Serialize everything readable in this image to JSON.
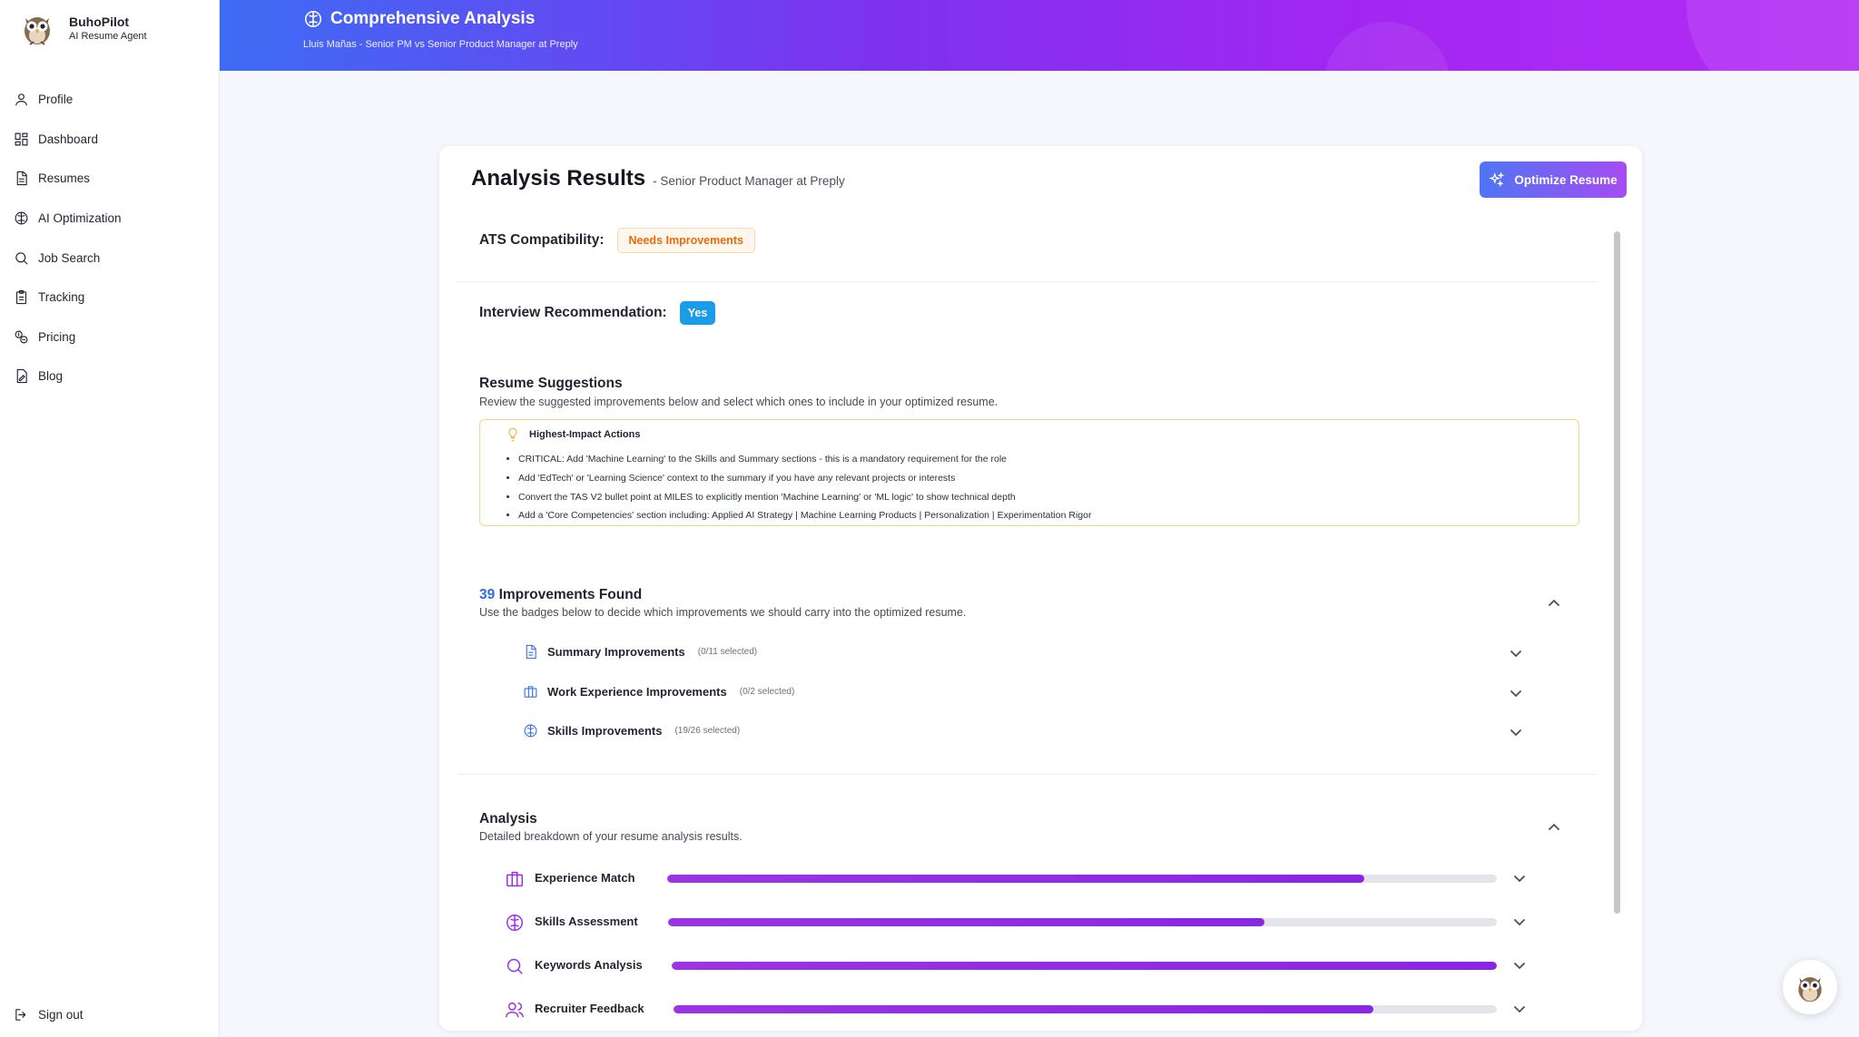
{
  "brand": {
    "name": "BuhoPilot",
    "tagline": "AI Resume Agent"
  },
  "nav": [
    {
      "label": "Profile",
      "icon": "user-icon"
    },
    {
      "label": "Dashboard",
      "icon": "grid-icon"
    },
    {
      "label": "Resumes",
      "icon": "document-icon"
    },
    {
      "label": "AI Optimization",
      "icon": "brain-icon"
    },
    {
      "label": "Job Search",
      "icon": "search-icon"
    },
    {
      "label": "Tracking",
      "icon": "clipboard-icon"
    },
    {
      "label": "Pricing",
      "icon": "tags-icon"
    },
    {
      "label": "Blog",
      "icon": "edit-document-icon"
    }
  ],
  "signout": "Sign out",
  "header": {
    "title": "Comprehensive Analysis",
    "subtitle": "Lluis Mañas - Senior PM vs Senior Product Manager at Preply"
  },
  "card": {
    "title": "Analysis Results",
    "subtitle": "- Senior Product Manager at Preply",
    "optimize_label": "Optimize Resume"
  },
  "ats": {
    "label": "ATS Compatibility:",
    "value": "Needs Improvements"
  },
  "interview": {
    "label": "Interview Recommendation:",
    "value": "Yes"
  },
  "suggestions": {
    "title": "Resume Suggestions",
    "subtitle": "Review the suggested improvements below and select which ones to include in your optimized resume.",
    "box_title": "Highest-Impact Actions",
    "items": [
      "CRITICAL: Add 'Machine Learning' to the Skills and Summary sections - this is a mandatory requirement for the role",
      "Add 'EdTech' or 'Learning Science' context to the summary if you have any relevant projects or interests",
      "Convert the TAS V2 bullet point at MILES to explicitly mention 'Machine Learning' or 'ML logic' to show technical depth",
      "Add a 'Core Competencies' section including: Applied AI Strategy | Machine Learning Products | Personalization | Experimentation Rigor"
    ]
  },
  "improvements": {
    "count": "39",
    "title": "Improvements Found",
    "subtitle": "Use the badges below to decide which improvements we should carry into the optimized resume.",
    "groups": [
      {
        "name": "Summary Improvements",
        "count": "(0/11 selected)",
        "icon": "document-icon"
      },
      {
        "name": "Work Experience Improvements",
        "count": "(0/2 selected)",
        "icon": "briefcase-icon"
      },
      {
        "name": "Skills Improvements",
        "count": "(19/26 selected)",
        "icon": "brain-icon"
      }
    ]
  },
  "analysis": {
    "title": "Analysis",
    "subtitle": "Detailed breakdown of your resume analysis results.",
    "rows": [
      {
        "name": "Experience Match",
        "icon": "briefcase-icon",
        "progress": 0.84
      },
      {
        "name": "Skills Assessment",
        "icon": "brain-icon",
        "progress": 0.72
      },
      {
        "name": "Keywords Analysis",
        "icon": "search-icon",
        "progress": 1.0
      },
      {
        "name": "Recruiter Feedback",
        "icon": "users-icon",
        "progress": 0.85
      }
    ]
  },
  "colors": {
    "accent_blue": "#3d6cf4",
    "accent_purple": "#a326f2",
    "warning": "#ea6a0c",
    "yes": "#1a9ce8",
    "progress": "#8a25e6"
  }
}
